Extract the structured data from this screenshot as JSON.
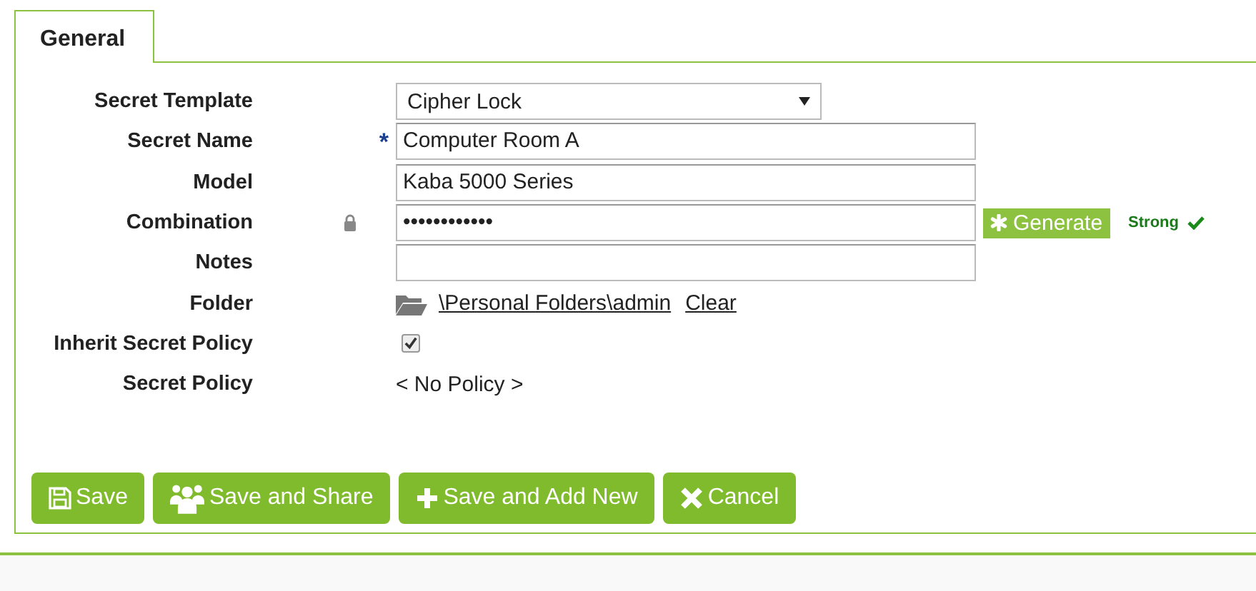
{
  "tabs": [
    {
      "label": "General",
      "selected": true
    }
  ],
  "fields": [
    {
      "kind": "select",
      "label": "Secret Template",
      "value": "Cipher Lock"
    },
    {
      "kind": "text",
      "label": "Secret Name",
      "required_mark": "*",
      "value": "Computer Room A"
    },
    {
      "kind": "text",
      "label": "Model",
      "value": "Kaba 5000 Series"
    },
    {
      "kind": "password",
      "label": "Combination",
      "locked": true,
      "value": "••••••••••••",
      "generate": "Generate",
      "strength": "Strong"
    },
    {
      "kind": "text",
      "label": "Notes"
    },
    {
      "kind": "folder",
      "label": "Folder",
      "path": "\\Personal Folders\\admin",
      "clear": "Clear"
    },
    {
      "kind": "checkbox",
      "label": "Inherit Secret Policy",
      "checked": true
    },
    {
      "kind": "static",
      "label": "Secret Policy",
      "value": "< No Policy >"
    }
  ],
  "buttons": [
    {
      "kind": "save",
      "label": "Save"
    },
    {
      "kind": "share",
      "label": "Save and Share"
    },
    {
      "kind": "add",
      "label": "Save and Add New"
    },
    {
      "kind": "cancel",
      "label": "Cancel"
    }
  ]
}
